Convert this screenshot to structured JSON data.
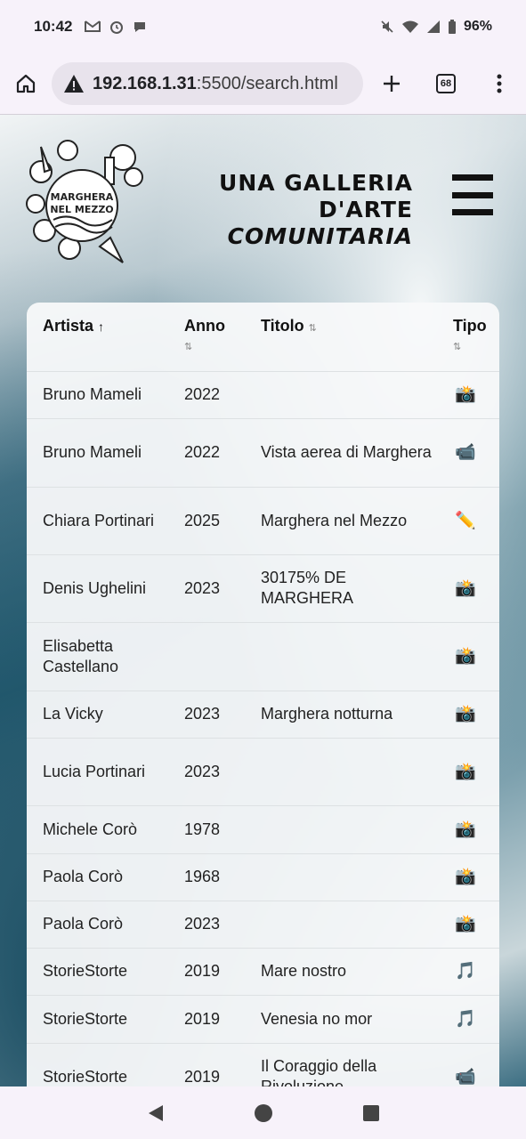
{
  "status_bar": {
    "time": "10:42",
    "icons_left": [
      "gmail-icon",
      "alarm-icon",
      "chat-icon"
    ],
    "icons_right": [
      "mute-icon",
      "wifi-icon",
      "signal-icon",
      "battery-icon"
    ],
    "battery": "96%"
  },
  "browser": {
    "url_host": "192.168.1.31",
    "url_path": ":5500/search.html",
    "tab_count": "68"
  },
  "header": {
    "logo_text": "MARGHERA NEL MEZZO",
    "tagline_line1": "UNA GALLERIA D'ARTE",
    "tagline_line2": "COMUNITARIA"
  },
  "table": {
    "columns": [
      {
        "label": "Artista",
        "sort": "↑"
      },
      {
        "label": "Anno",
        "sort": "⇅"
      },
      {
        "label": "Titolo",
        "sort": "⇅"
      },
      {
        "label": "Tipo",
        "sort": "⇅"
      }
    ],
    "rows": [
      {
        "artista": "Bruno Mameli",
        "anno": "2022",
        "titolo": "",
        "tipo": "📸"
      },
      {
        "artista": "Bruno Mameli",
        "anno": "2022",
        "titolo": "Vista aerea di Marghera",
        "tipo": "📹"
      },
      {
        "artista": "Chiara Portinari",
        "anno": "2025",
        "titolo": "Marghera nel Mezzo",
        "tipo": "✏️"
      },
      {
        "artista": "Denis Ughelini",
        "anno": "2023",
        "titolo": "30175% DE MARGHERA",
        "tipo": "📸"
      },
      {
        "artista": "Elisabetta Castellano",
        "anno": "",
        "titolo": "",
        "tipo": "📸"
      },
      {
        "artista": "La Vicky",
        "anno": "2023",
        "titolo": "Marghera notturna",
        "tipo": "📸"
      },
      {
        "artista": "Lucia Portinari",
        "anno": "2023",
        "titolo": "",
        "tipo": "📸"
      },
      {
        "artista": "Michele Corò",
        "anno": "1978",
        "titolo": "",
        "tipo": "📸"
      },
      {
        "artista": "Paola Corò",
        "anno": "1968",
        "titolo": "",
        "tipo": "📸"
      },
      {
        "artista": "Paola Corò",
        "anno": "2023",
        "titolo": "",
        "tipo": "📸"
      },
      {
        "artista": "StorieStorte",
        "anno": "2019",
        "titolo": "Mare nostro",
        "tipo": "🎵"
      },
      {
        "artista": "StorieStorte",
        "anno": "2019",
        "titolo": "Venesia no mor",
        "tipo": "🎵"
      },
      {
        "artista": "StorieStorte",
        "anno": "2019",
        "titolo": "Il Coraggio della Rivoluzione",
        "tipo": "📹"
      }
    ]
  },
  "nav_bar": {
    "buttons": [
      "back",
      "home",
      "recents"
    ]
  }
}
